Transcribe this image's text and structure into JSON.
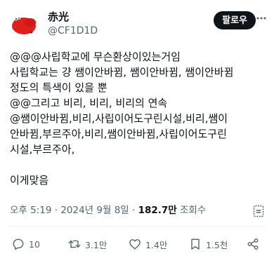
{
  "author": {
    "display_name": "赤光",
    "handle": "@CF1D1D",
    "avatar": "red-blob-avatar"
  },
  "follow_label": "팔로우",
  "more_icon": "ellipsis-icon",
  "tweet_lines": [
    "@@@사립학교에 무슨환상이있는거임",
    "사립학교는 걍 쌤이안바뀜, 쌤이안바뀜, 쌤이안바뀜",
    "정도의 특색이 있을 뿐",
    "@@그리고 비리, 비리, 비리의 연속",
    "@쌤이안바뀜,비리,사립이어도구린시설,비리,쌤이",
    "안바뀜,부르주아,비리,쌤이안바뀜,사립이어도구린",
    "시설,부르주아,",
    "",
    "이게맞음"
  ],
  "meta": {
    "time": "오후 5:19",
    "separator": " · ",
    "date": "2024년 9월 8일",
    "views_count": "182.7만",
    "views_label": " 조회수"
  },
  "actions": {
    "replies": "10",
    "retweets": "3.1만",
    "likes": "1.4만",
    "bookmarks": "1.5천"
  },
  "colors": {
    "text": "#0f1419",
    "muted": "#536471",
    "avatar_red": "#e0201b",
    "divider": "#eff3f4"
  }
}
